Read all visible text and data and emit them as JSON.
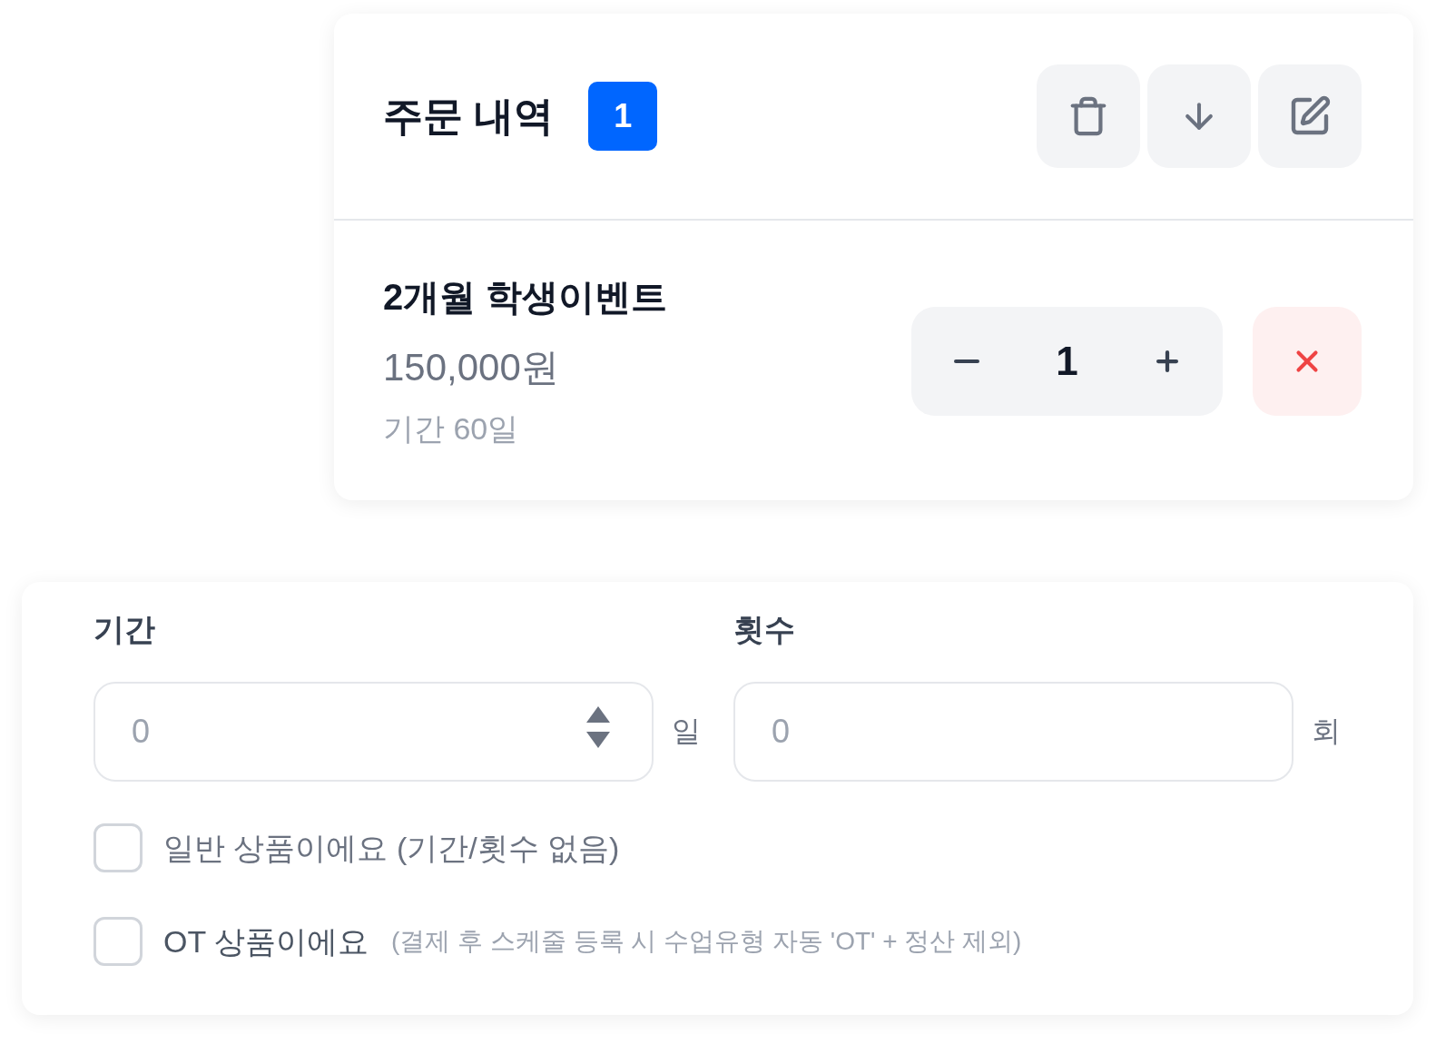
{
  "order_panel": {
    "title": "주문 내역",
    "count_badge": "1",
    "items": [
      {
        "name": "2개월 학생이벤트",
        "price": "150,000원",
        "duration": "기간 60일",
        "quantity": "1"
      }
    ]
  },
  "product_settings": {
    "fields": [
      {
        "label": "기간",
        "placeholder": "0",
        "unit": "일",
        "kind": "number"
      },
      {
        "label": "횟수",
        "placeholder": "0",
        "unit": "회",
        "kind": "text"
      }
    ],
    "options": [
      {
        "label": "일반 상품이에요 (기간/횟수 없음)",
        "checked": false
      },
      {
        "label": "OT 상품이에요",
        "note": "(결제 후 스케줄 등록 시 수업유형 자동 'OT' + 정산 제외)",
        "checked": false
      }
    ]
  }
}
